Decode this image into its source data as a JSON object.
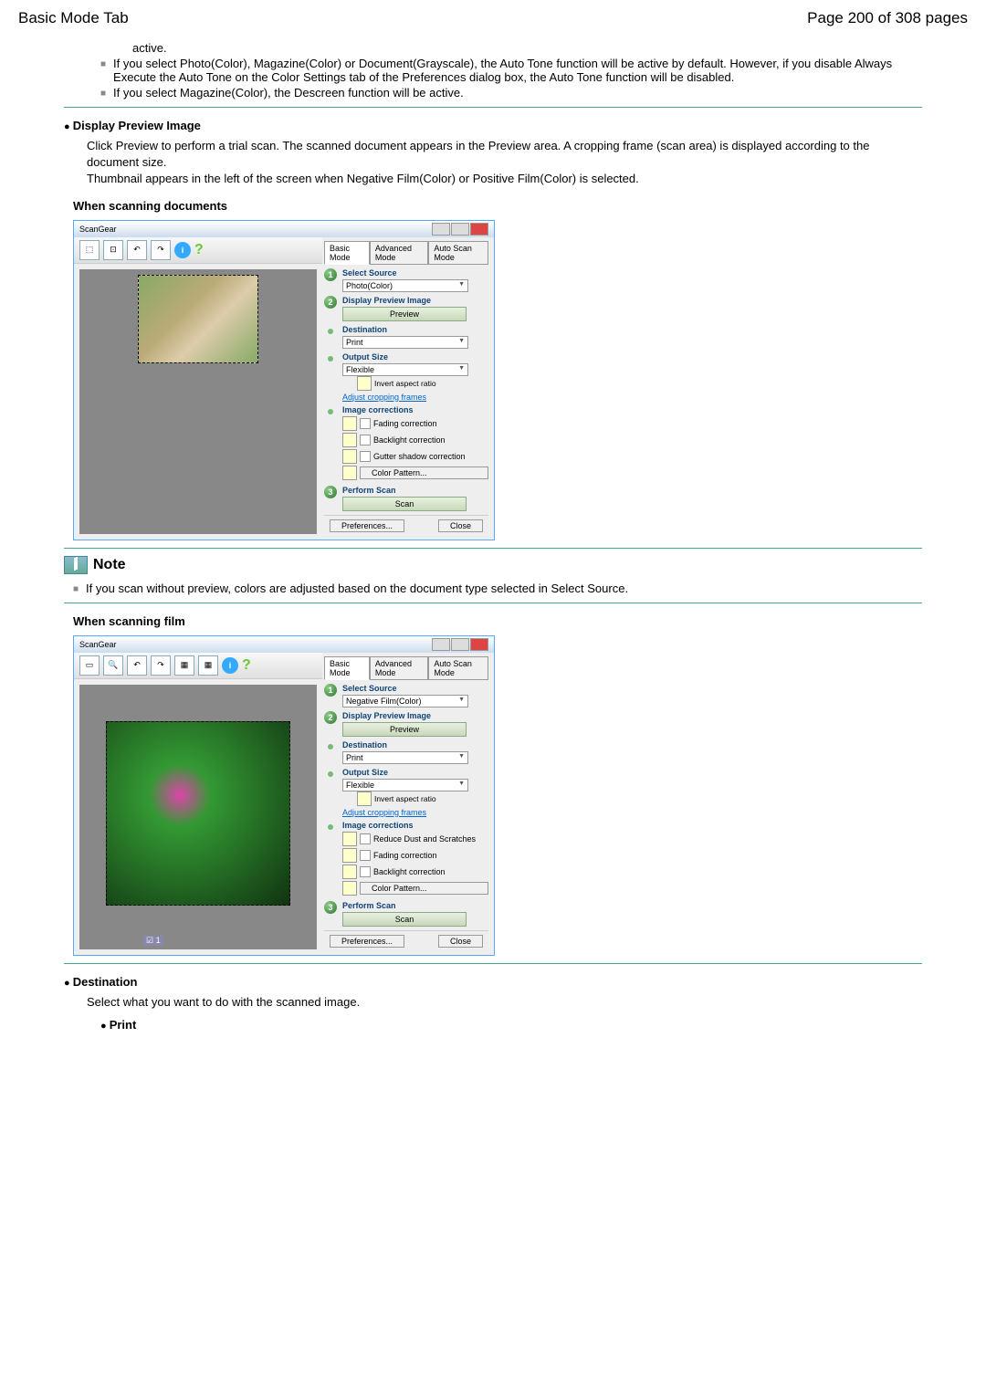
{
  "header": {
    "left": "Basic Mode Tab",
    "right": "Page 200 of 308 pages"
  },
  "top_bullets": [
    "active.",
    "If you select Photo(Color), Magazine(Color) or Document(Grayscale), the Auto Tone function will be active by default. However, if you disable Always Execute the Auto Tone on the Color Settings tab of the Preferences dialog box, the Auto Tone function will be disabled.",
    "If you select Magazine(Color), the Descreen function will be active."
  ],
  "display_preview": {
    "title": "Display Preview Image",
    "body": "Click Preview to perform a trial scan. The scanned document appears in the Preview area. A cropping frame (scan area) is displayed according to the document size.\nThumbnail appears in the left of the screen when Negative Film(Color) or Positive Film(Color) is selected."
  },
  "when_docs": "When scanning documents",
  "when_film": "When scanning film",
  "note": {
    "label": "Note",
    "text": "If you scan without preview, colors are adjusted based on the document type selected in Select Source."
  },
  "destination": {
    "title": "Destination",
    "body": "Select what you want to do with the scanned image.",
    "print": "Print"
  },
  "sg": {
    "title": "ScanGear",
    "tabs": [
      "Basic Mode",
      "Advanced Mode",
      "Auto Scan Mode"
    ],
    "step1": "Select Source",
    "source_doc": "Photo(Color)",
    "source_film": "Negative Film(Color)",
    "step2": "Display Preview Image",
    "preview_btn": "Preview",
    "dest": "Destination",
    "dest_val": "Print",
    "outsize": "Output Size",
    "outsize_val": "Flexible",
    "invert": "Invert aspect ratio",
    "adjust": "Adjust cropping frames",
    "corrections": "Image corrections",
    "reduce_dust": "Reduce Dust and Scratches",
    "fading": "Fading correction",
    "backlight": "Backlight correction",
    "gutter": "Gutter shadow correction",
    "color_pattern": "Color Pattern...",
    "step3": "Perform Scan",
    "scan": "Scan",
    "prefs": "Preferences...",
    "close": "Close",
    "film_check": "1"
  }
}
